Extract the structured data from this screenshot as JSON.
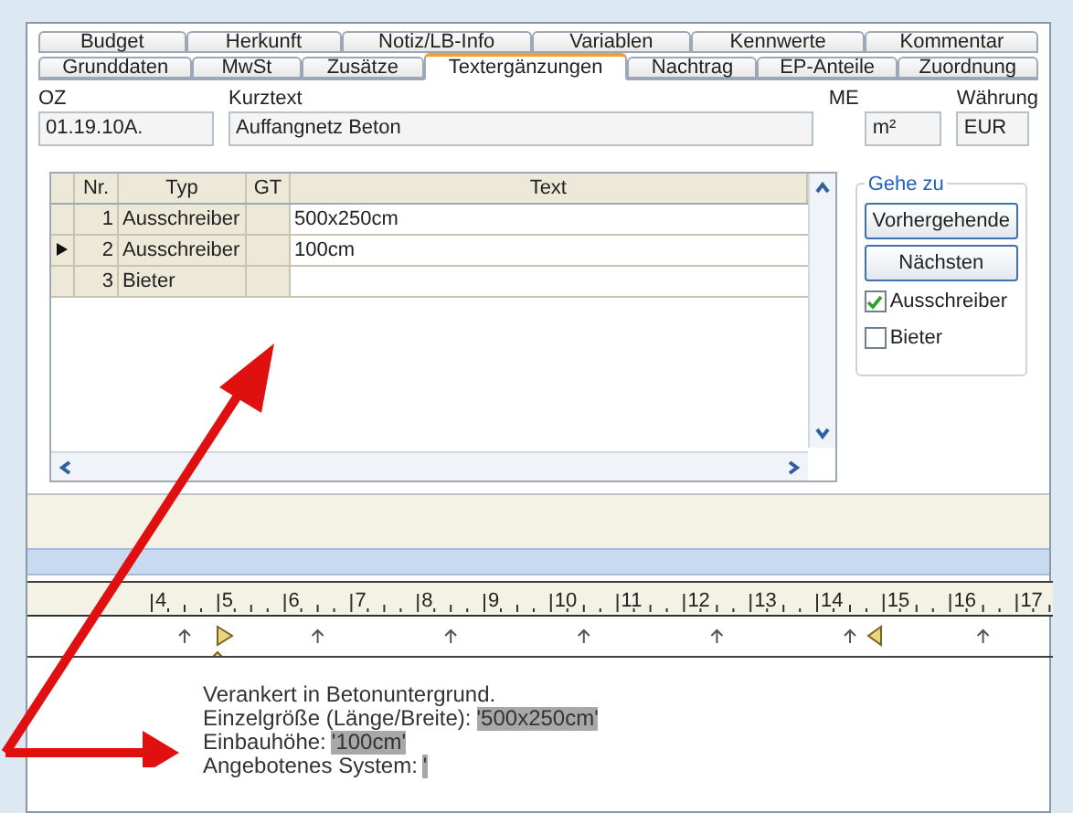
{
  "tabs_back": [
    {
      "label": "Budget",
      "selected": false
    },
    {
      "label": "Herkunft",
      "selected": false
    },
    {
      "label": "Notiz/LB-Info",
      "selected": false
    },
    {
      "label": "Variablen",
      "selected": false
    },
    {
      "label": "Kennwerte",
      "selected": false
    },
    {
      "label": "Kommentar",
      "selected": false
    }
  ],
  "tabs_front": [
    {
      "label": "Grunddaten",
      "selected": false
    },
    {
      "label": "MwSt",
      "selected": false
    },
    {
      "label": "Zusätze",
      "selected": false
    },
    {
      "label": "Textergänzungen",
      "selected": true
    },
    {
      "label": "Nachtrag",
      "selected": false
    },
    {
      "label": "EP-Anteile",
      "selected": false
    },
    {
      "label": "Zuordnung",
      "selected": false
    }
  ],
  "fields": [
    {
      "label": "OZ",
      "value": "01.19.10A."
    },
    {
      "label": "Kurztext",
      "value": "Auffangnetz Beton"
    },
    {
      "label": "ME",
      "value": "m²"
    },
    {
      "label": "Währung",
      "value": "EUR"
    }
  ],
  "table": {
    "columns": [
      "Nr.",
      "Typ",
      "GT",
      "Text"
    ],
    "rows": [
      {
        "nr": "1",
        "typ": "Ausschreiber",
        "text": "500x250cm",
        "selected": false
      },
      {
        "nr": "2",
        "typ": "Ausschreiber",
        "text": "100cm",
        "selected": true
      },
      {
        "nr": "3",
        "typ": "Bieter",
        "selected": false
      }
    ]
  },
  "goto": {
    "title": "Gehe zu",
    "buttons": [
      "Vorhergehende",
      "Nächsten"
    ],
    "filters": [
      {
        "label": "Ausschreiber",
        "checked": true
      },
      {
        "label": "Bieter",
        "checked": false
      }
    ]
  },
  "ruler": {
    "marks": [
      "4",
      "5",
      "6",
      "7",
      "8",
      "9",
      "10",
      "11",
      "12",
      "13",
      "14",
      "15",
      "16",
      "17"
    ]
  },
  "document": [
    {
      "text": "Verankert in Betonuntergrund."
    },
    {
      "text": "Einzelgröße (Länge/Breite):",
      "value": "'500x250cm'"
    },
    {
      "text": "Einbauhöhe:",
      "value": "'100cm'"
    },
    {
      "text": "Angebotenes System:",
      "value": "'"
    }
  ]
}
